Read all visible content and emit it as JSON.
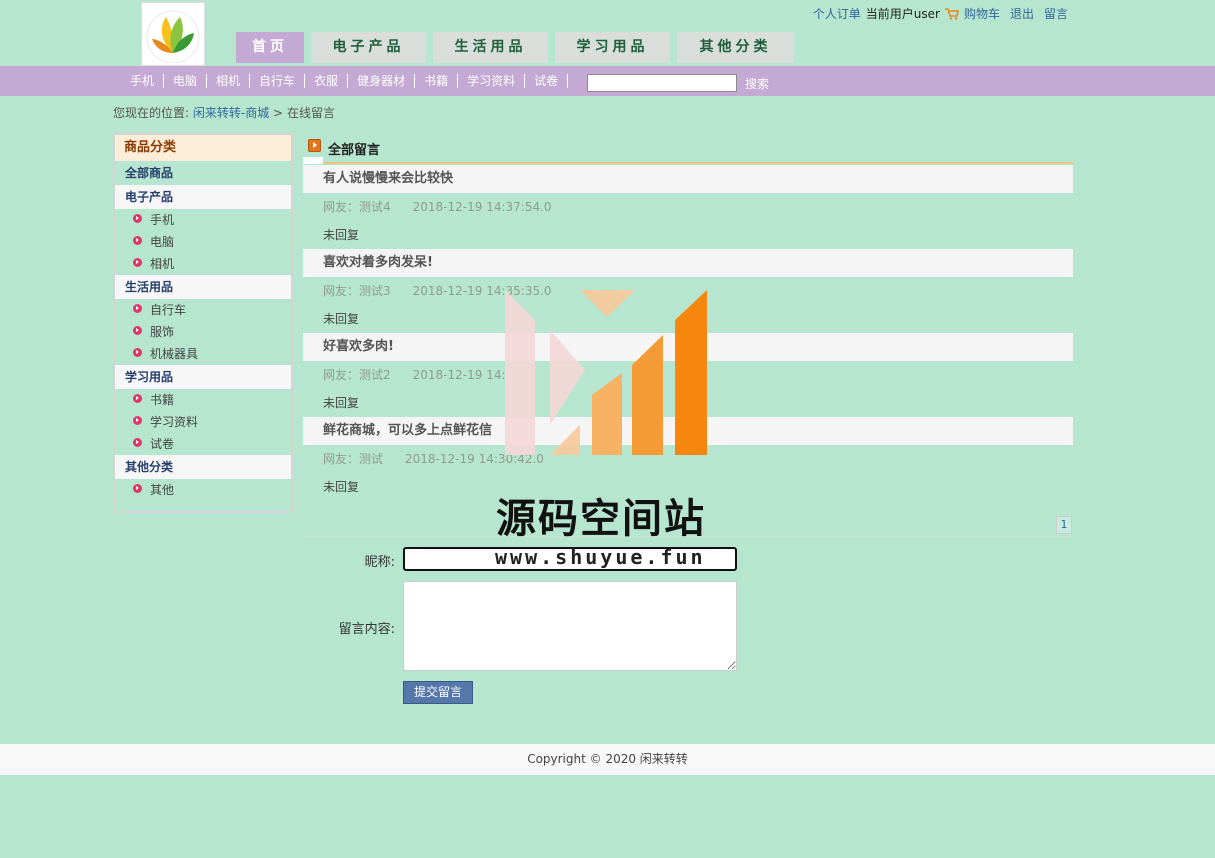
{
  "header": {
    "top_links": {
      "orders": "个人订单",
      "current_user": "当前用户user",
      "cart": "购物车",
      "logout": "退出",
      "message": "留言"
    },
    "main_nav": [
      "首页",
      "电子产品",
      "生活用品",
      "学习用品",
      "其他分类"
    ],
    "sub_nav": [
      "手机",
      "电脑",
      "相机",
      "自行车",
      "衣服",
      "健身器材",
      "书籍",
      "学习资料",
      "试卷"
    ],
    "search": {
      "button": "搜索",
      "value": ""
    }
  },
  "breadcrumb": {
    "prefix": "您现在的位置:",
    "home": "闲来转转-商城",
    "sep": ">",
    "current": "在线留言"
  },
  "sidebar": {
    "title": "商品分类",
    "all": "全部商品",
    "groups": [
      {
        "name": "电子产品",
        "items": [
          "手机",
          "电脑",
          "相机"
        ]
      },
      {
        "name": "生活用品",
        "items": [
          "自行车",
          "服饰",
          "机械器具"
        ]
      },
      {
        "name": "学习用品",
        "items": [
          "书籍",
          "学习资料",
          "试卷"
        ]
      },
      {
        "name": "其他分类",
        "items": [
          "其他"
        ]
      }
    ]
  },
  "content": {
    "title": "全部留言",
    "messages": [
      {
        "subject": "有人说慢慢来会比较快",
        "user": "网友：测试4",
        "time": "2018-12-19 14:37:54.0",
        "reply": "未回复"
      },
      {
        "subject": "喜欢对着多肉发呆!",
        "user": "网友：测试3",
        "time": "2018-12-19 14:35:35.0",
        "reply": "未回复"
      },
      {
        "subject": "好喜欢多肉!",
        "user": "网友：测试2",
        "time": "2018-12-19 14:",
        "reply": "未回复"
      },
      {
        "subject": "鲜花商城，可以多上点鲜花信",
        "user": "网友：测试",
        "time": "2018-12-19 14:30:42.0",
        "reply": "未回复"
      }
    ],
    "page": "1"
  },
  "form": {
    "nickname_label": "昵称:",
    "content_label": "留言内容:",
    "submit": "提交留言"
  },
  "watermark": {
    "title": "源码空间站",
    "url": "www.shuyue.fun"
  },
  "footer": {
    "copyright": "Copyright © 2020 闲来转转"
  }
}
